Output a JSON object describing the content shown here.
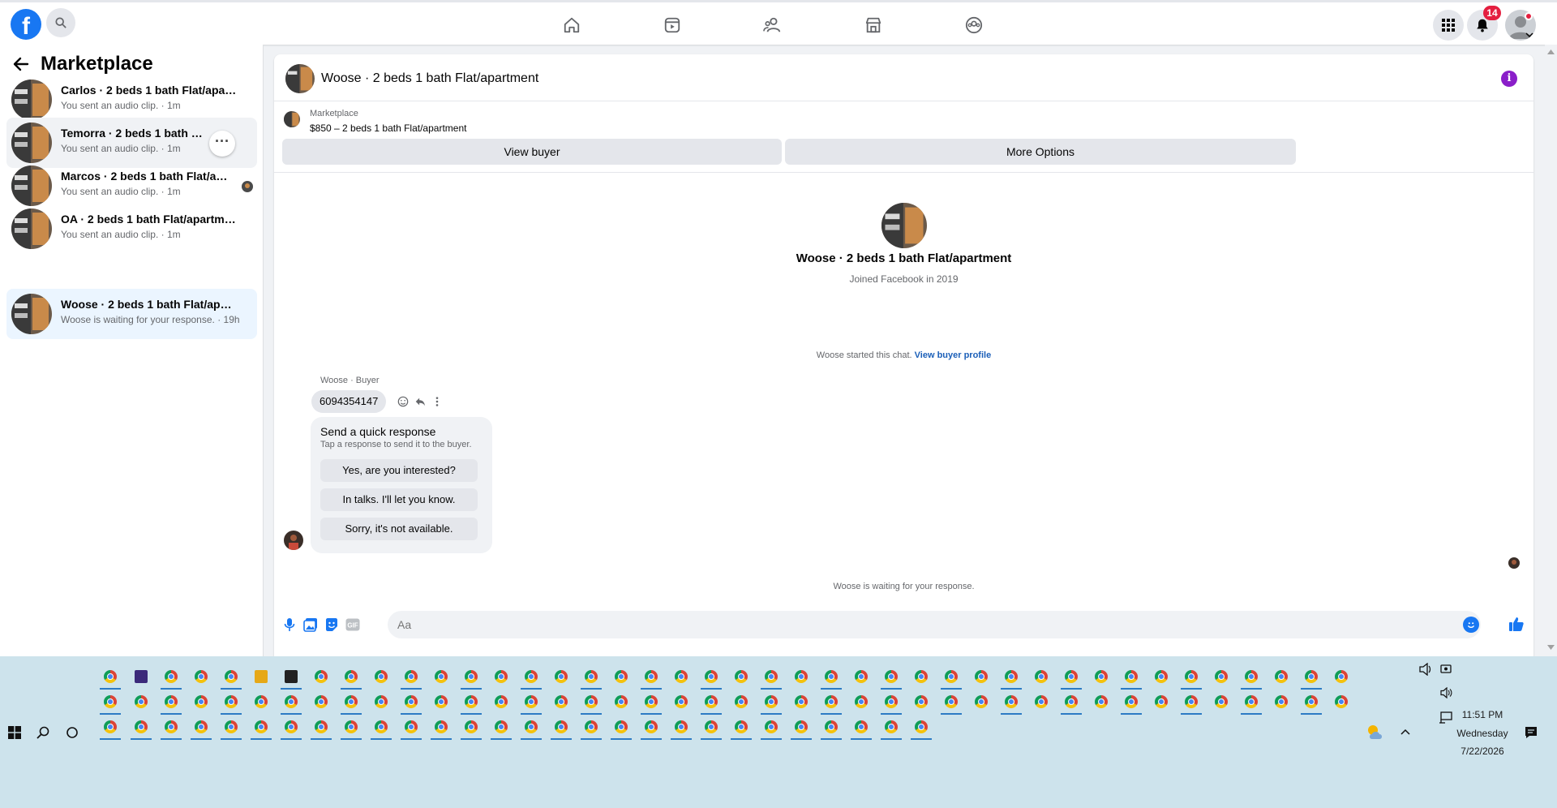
{
  "topbar": {
    "logo": "f",
    "notification_count": "14",
    "nav_icons": [
      "home-icon",
      "video-icon",
      "friends-icon",
      "marketplace-icon",
      "groups-icon"
    ]
  },
  "sidebar": {
    "title": "Marketplace",
    "conversations": [
      {
        "title": "Carlos · 2 beds 1 bath Flat/apartm...",
        "subtitle": "You sent an audio clip. · 1m"
      },
      {
        "title": "Temorra · 2 beds 1 bath Flat/ap...",
        "subtitle": "You sent an audio clip. · 1m"
      },
      {
        "title": "Marcos · 2 beds 1 bath Flat/apar...",
        "subtitle": "You sent an audio clip. · 1m"
      },
      {
        "title": "OA · 2 beds 1 bath Flat/apartment",
        "subtitle": "You sent an audio clip. · 1m"
      },
      {
        "title": "Woose · 2 beds 1 bath Flat/apartm...",
        "subtitle": "Woose is waiting for your response. · 19h"
      }
    ]
  },
  "chat": {
    "header_title": "Woose · 2 beds 1 bath Flat/apartment",
    "listing_label": "Marketplace",
    "listing_price": "$850 – 2 beds 1 bath Flat/apartment",
    "view_buyer": "View buyer",
    "more_options": "More Options",
    "profile_name": "Woose · 2 beds 1 bath Flat/apartment",
    "profile_joined": "Joined Facebook in 2019",
    "started_text": "Woose started this chat.",
    "started_link": "View buyer profile",
    "sender_label": "Woose · Buyer",
    "message": "6094354147",
    "quick_title": "Send a quick response",
    "quick_sub": "Tap a response to send it to the buyer.",
    "quick_responses": [
      "Yes, are you interested?",
      "In talks. I'll let you know.",
      "Sorry, it's not available."
    ],
    "waiting_text": "Woose is waiting for your response.",
    "composer_placeholder": "Aa"
  },
  "taskbar": {
    "time": "11:51 PM",
    "day": "Wednesday",
    "date": "7/22/2026"
  },
  "colors": {
    "brand": "#1877f2",
    "active_item": "#ebf5ff",
    "badge": "#e41e3f",
    "taskbar": "#cde3ec"
  }
}
